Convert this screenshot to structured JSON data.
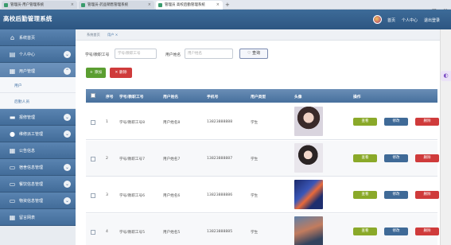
{
  "browser": {
    "tabs": [
      {
        "label": "管理员-用户管理系统",
        "active": false
      },
      {
        "label": "管理员-药品销售管理系统",
        "active": false
      },
      {
        "label": "管理员 高校后勤管理系统",
        "active": true
      }
    ],
    "new_tab": "+",
    "window_controls": [
      "—",
      "□",
      "✕"
    ]
  },
  "header": {
    "app_title": "高校后勤管理系统",
    "links": {
      "home": "首页",
      "profile": "个人中心",
      "logout": "退出登录"
    }
  },
  "sidebar": {
    "items": [
      {
        "label": "系统首页",
        "icon": "home-icon",
        "glyph": "⌂",
        "expandable": false
      },
      {
        "label": "个人中心",
        "icon": "id-card-icon",
        "glyph": "▤",
        "expandable": true
      },
      {
        "label": "用户管理",
        "icon": "grid-icon",
        "glyph": "▦",
        "expandable": true,
        "active": true
      }
    ],
    "submenu": [
      {
        "label": "用户"
      },
      {
        "label": "后勤人员"
      }
    ],
    "items_lower": [
      {
        "label": "报修管理",
        "icon": "chat-icon",
        "glyph": "▬",
        "expandable": true
      },
      {
        "label": "维修派工管理",
        "icon": "person-icon",
        "glyph": "●",
        "expandable": true
      },
      {
        "label": "公告信息",
        "icon": "grid-icon",
        "glyph": "▦",
        "expandable": false
      },
      {
        "label": "宿舍信息管理",
        "icon": "archive-icon",
        "glyph": "▭",
        "expandable": true
      },
      {
        "label": "餐饮信息管理",
        "icon": "archive-icon",
        "glyph": "▭",
        "expandable": true
      },
      {
        "label": "物资信息管理",
        "icon": "archive-icon",
        "glyph": "▭",
        "expandable": true
      },
      {
        "label": "留言网表",
        "icon": "grid-icon",
        "glyph": "▦",
        "expandable": false
      }
    ]
  },
  "breadcrumb": [
    "系统首页",
    "用户 ×"
  ],
  "search": {
    "field1_label": "学号/教职工号",
    "field1_placeholder": "学号/教职工号",
    "field2_label": "用户姓名",
    "field2_placeholder": "用户姓名",
    "button": "♡ 查询"
  },
  "actions": {
    "add": "+ 添加",
    "delete": "✕ 删除"
  },
  "table": {
    "headers": [
      "序号",
      "学号/教职工号",
      "用户姓名",
      "手机号",
      "用户类型",
      "头像",
      "操作"
    ],
    "rows": [
      {
        "index": "1",
        "id": "学号/教职工号8",
        "name": "用户姓名8",
        "phone": "13823888888",
        "type": "学生"
      },
      {
        "index": "2",
        "id": "学号/教职工号7",
        "name": "用户姓名7",
        "phone": "13823888887",
        "type": "学生"
      },
      {
        "index": "3",
        "id": "学号/教职工号6",
        "name": "用户姓名6",
        "phone": "13823888886",
        "type": "学生"
      },
      {
        "index": "4",
        "id": "学号/教职工号5",
        "name": "用户姓名5",
        "phone": "13823888885",
        "type": "学生"
      }
    ],
    "row_actions": {
      "view": "查看",
      "edit": "修改",
      "delete": "删除"
    }
  },
  "colors": {
    "header": "#2d5682",
    "sidebar_item": "#4a74a2",
    "view_button": "#8aa929",
    "edit_button": "#3f6a97",
    "delete_button": "#cf3b3b",
    "add_button": "#5b9e31"
  }
}
